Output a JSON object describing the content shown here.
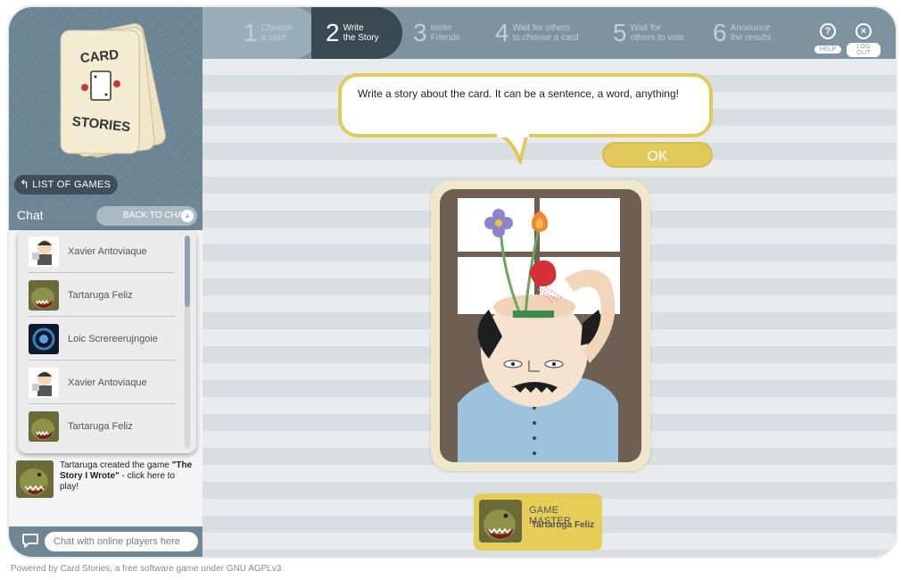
{
  "sidebar": {
    "logo_text": "CARD STORIES",
    "list_games_label": "LIST OF GAMES",
    "chat": {
      "title": "Chat",
      "back_to_chat_label": "BACK TO CHAT",
      "players": [
        {
          "name": "Xavier Antoviaque",
          "avatar": "xavier-avatar"
        },
        {
          "name": "Tartaruga Feliz",
          "avatar": "monster-avatar"
        },
        {
          "name": "Loic Screreerujngoie",
          "avatar": "space-avatar"
        },
        {
          "name": "Xavier Antoviaque",
          "avatar": "xavier-avatar"
        },
        {
          "name": "Tartaruga Feliz",
          "avatar": "monster-avatar"
        }
      ],
      "message": {
        "prefix": "Tartaruga created the game",
        "game_name": "\"The Story I Wrote\"",
        "suffix": "- click here to play!"
      },
      "input_placeholder": "Chat with online players here"
    }
  },
  "steps": [
    {
      "num": "1",
      "line1": "Choose",
      "line2": "a card",
      "state": "done"
    },
    {
      "num": "2",
      "line1": "Write",
      "line2": "the Story",
      "state": "active"
    },
    {
      "num": "3",
      "line1": "Invite",
      "line2": "Friends",
      "state": "pending"
    },
    {
      "num": "4",
      "line1": "Wait for others",
      "line2": "to choose a card",
      "state": "pending"
    },
    {
      "num": "5",
      "line1": "Wait for",
      "line2": "others to vote",
      "state": "pending"
    },
    {
      "num": "6",
      "line1": "Announce",
      "line2": "the results",
      "state": "pending"
    }
  ],
  "top_buttons": {
    "help_label": "HELP",
    "logout_label": "LOG OUT"
  },
  "story": {
    "text": "Write a story about the card. It can be a sentence, a word, anything!",
    "ok_label": "OK"
  },
  "game_master": {
    "label": "GAME MASTER",
    "name": "Tartaruga Feliz"
  },
  "footer": "Powered by Card Stories, a free software game under GNU AGPLv3",
  "colors": {
    "accent_yellow": "#e2c95c",
    "step_active": "#3a4a53",
    "sidebar_blue": "#6f8794"
  }
}
